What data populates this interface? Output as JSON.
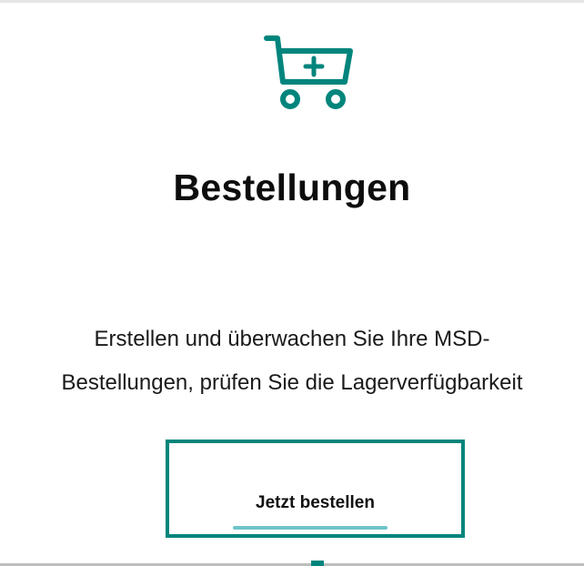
{
  "card": {
    "icon": "cart-plus-icon",
    "title": "Bestellungen",
    "description": "Erstellen und überwachen Sie Ihre MSD-Bestellungen, prüfen Sie die Lagerverfügbarkeit",
    "cta_label": "Jetzt bestellen"
  },
  "colors": {
    "accent": "#00857c",
    "underline": "#6ec3c8",
    "text": "#111111"
  }
}
